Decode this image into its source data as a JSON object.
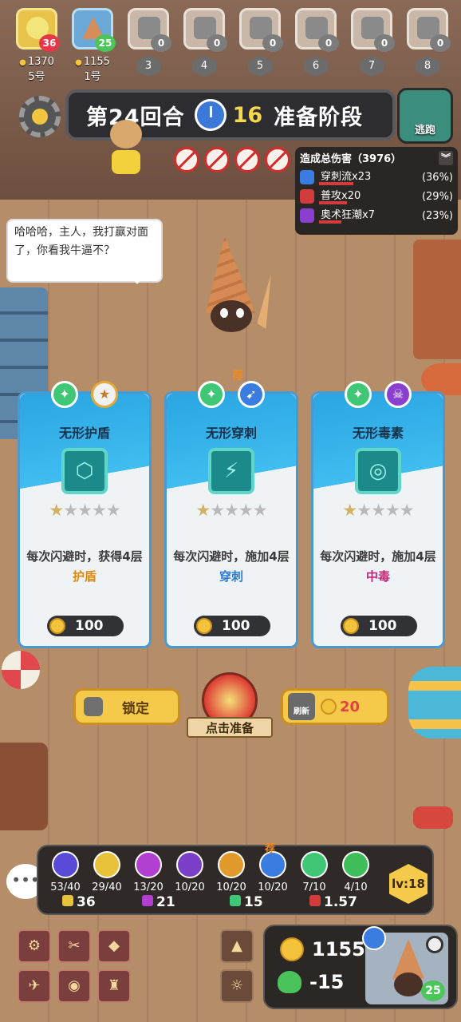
{
  "players": [
    {
      "money": "1370",
      "name": "5号",
      "hp": "36",
      "hp_color": "red"
    },
    {
      "money": "1155",
      "name": "1号",
      "hp": "25",
      "hp_color": "green"
    },
    {
      "rank": "3",
      "hp": "0"
    },
    {
      "rank": "4",
      "hp": "0"
    },
    {
      "rank": "5",
      "hp": "0"
    },
    {
      "rank": "6",
      "hp": "0"
    },
    {
      "rank": "7",
      "hp": "0"
    },
    {
      "rank": "8",
      "hp": "0"
    }
  ],
  "round": {
    "label": "第24回合",
    "countdown": "16",
    "phase": "准备阶段",
    "escape_label": "逃跑"
  },
  "damage": {
    "header": "造成总伤害（3976）",
    "rows": [
      {
        "name": "穿刺流x23",
        "pct": "(36%)",
        "share": 0.36,
        "color": "#3a7ce0"
      },
      {
        "name": "普攻x20",
        "pct": "(29%)",
        "share": 0.29,
        "color": "#d33c3c"
      },
      {
        "name": "奥术狂潮x7",
        "pct": "(23%)",
        "share": 0.23,
        "color": "#8a3fcf"
      }
    ]
  },
  "speech": "哈哈哈，主人，我打赢对面了，你看我牛逼不？",
  "cards": [
    {
      "title": "无形护盾",
      "desc_a": "每次闪避时，获得4层",
      "keyword": "护盾",
      "price": "100",
      "stars": 1,
      "tags": [
        "evade-icon",
        "shield-icon"
      ],
      "recommended": false
    },
    {
      "title": "无形穿刺",
      "desc_a": "每次闪避时，施加4层",
      "keyword": "穿刺",
      "price": "100",
      "stars": 1,
      "tags": [
        "evade-icon",
        "pierce-icon"
      ],
      "recommended": true
    },
    {
      "title": "无形毒素",
      "desc_a": "每次闪避时，施加4层",
      "keyword": "中毒",
      "price": "100",
      "stars": 1,
      "tags": [
        "evade-icon",
        "poison-icon"
      ],
      "recommended": false
    }
  ],
  "recommend_label": "荐",
  "actions": {
    "lock_label": "锁定",
    "prepare_label": "点击准备",
    "refresh_label": "刷新",
    "refresh_cost": "20"
  },
  "traits": [
    {
      "count": "53/40",
      "color": "#5a4ad8"
    },
    {
      "count": "29/40",
      "color": "#e8c23a"
    },
    {
      "count": "13/20",
      "color": "#b23fd0"
    },
    {
      "count": "10/20",
      "color": "#7b3fc8"
    },
    {
      "count": "10/20",
      "color": "#e39a2c"
    },
    {
      "count": "10/20",
      "color": "#3a7ce0",
      "recommended": true
    },
    {
      "count": "7/10",
      "color": "#3fc775"
    },
    {
      "count": "4/10",
      "color": "#3fbf5a"
    }
  ],
  "stats": [
    "36",
    "21",
    "15",
    "1.57"
  ],
  "level": "lv:18",
  "wallet": {
    "gold": "1155",
    "hp_change": "-15",
    "portrait_hp": "25"
  }
}
